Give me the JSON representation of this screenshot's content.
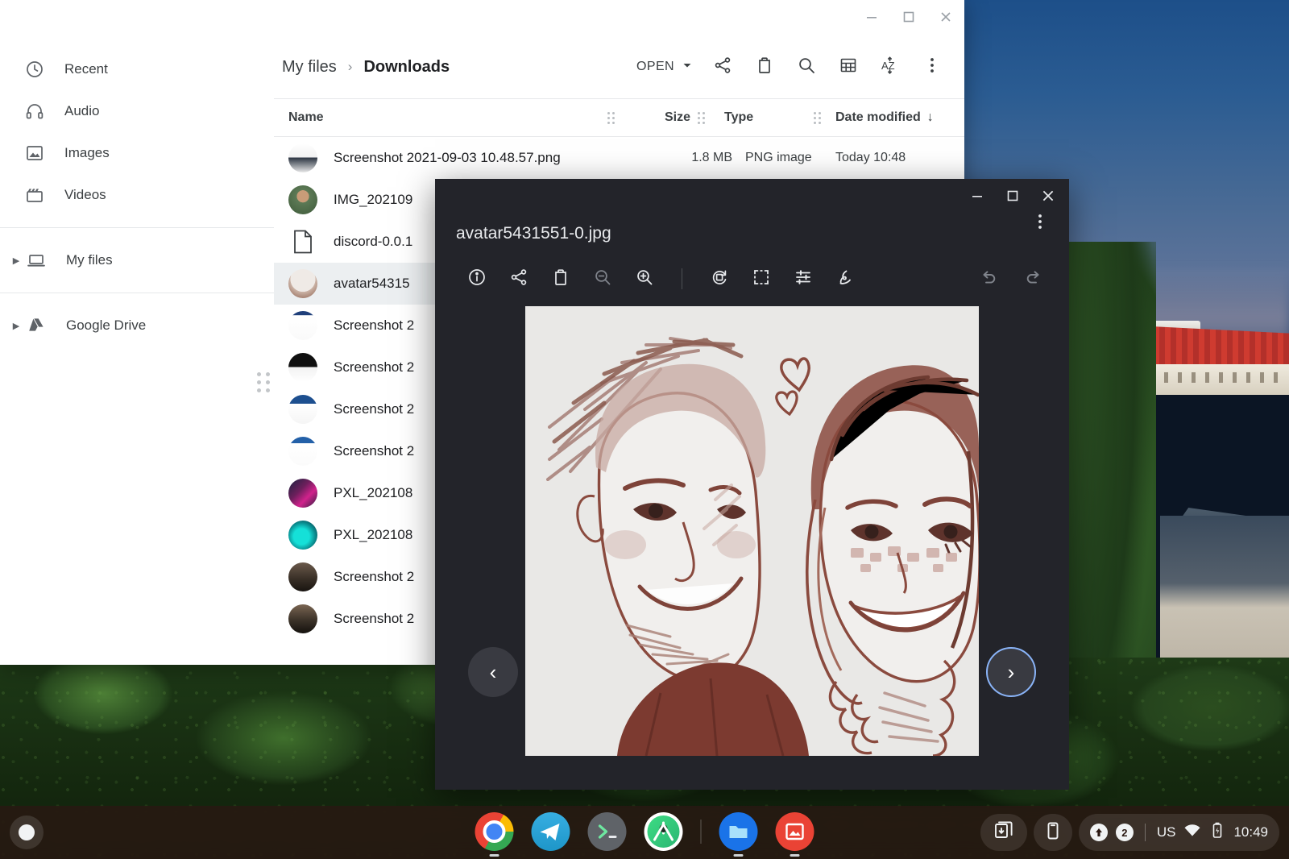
{
  "desktop": {
    "wallpaper_description": "Tallinn old town at dusk with red roofs and green trees"
  },
  "files_app": {
    "window_controls": [
      {
        "name": "minimize",
        "glyph": "minimize-icon"
      },
      {
        "name": "maximize",
        "glyph": "maximize-icon"
      },
      {
        "name": "close",
        "glyph": "close-icon"
      }
    ],
    "sidebar": {
      "items": [
        {
          "label": "Recent",
          "icon": "clock-icon",
          "expandable": false
        },
        {
          "label": "Audio",
          "icon": "headphones-icon",
          "expandable": false
        },
        {
          "label": "Images",
          "icon": "image-icon",
          "expandable": false
        },
        {
          "label": "Videos",
          "icon": "video-icon",
          "expandable": false
        },
        {
          "label": "My files",
          "icon": "laptop-icon",
          "expandable": true
        },
        {
          "label": "Google Drive",
          "icon": "google-drive-icon",
          "expandable": true
        }
      ]
    },
    "breadcrumb": {
      "root": "My files",
      "separator": "›",
      "current": "Downloads"
    },
    "toolbar": {
      "open_label": "OPEN",
      "buttons": [
        {
          "name": "share-button",
          "icon": "share-icon"
        },
        {
          "name": "delete-button",
          "icon": "trash-icon"
        },
        {
          "name": "search-button",
          "icon": "search-icon"
        },
        {
          "name": "view-toggle-button",
          "icon": "grid-icon"
        },
        {
          "name": "sort-button",
          "icon": "sort-az-icon"
        },
        {
          "name": "more-button",
          "icon": "more-vertical-icon"
        }
      ]
    },
    "table": {
      "columns": [
        "Name",
        "Size",
        "Type",
        "Date modified"
      ],
      "sort_indicator": "↓",
      "rows": [
        {
          "name": "Screenshot 2021-09-03 10.48.57.png",
          "size": "1.8 MB",
          "type": "PNG image",
          "date": "Today 10:48",
          "thumb": "screenshot",
          "selected": false
        },
        {
          "name": "IMG_202109",
          "size": "",
          "type": "",
          "date": "",
          "thumb": "photo-person",
          "selected": false
        },
        {
          "name": "discord-0.0.1",
          "size": "",
          "type": "",
          "date": "",
          "thumb": "generic-file",
          "selected": false
        },
        {
          "name": "avatar54315",
          "size": "",
          "type": "",
          "date": "",
          "thumb": "avatar-sketch",
          "selected": true
        },
        {
          "name": "Screenshot 2",
          "size": "",
          "type": "",
          "date": "",
          "thumb": "screenshot-blue",
          "selected": false
        },
        {
          "name": "Screenshot 2",
          "size": "",
          "type": "",
          "date": "",
          "thumb": "screenshot-dark",
          "selected": false
        },
        {
          "name": "Screenshot 2",
          "size": "",
          "type": "",
          "date": "",
          "thumb": "screenshot-blue2",
          "selected": false
        },
        {
          "name": "Screenshot 2",
          "size": "",
          "type": "",
          "date": "",
          "thumb": "screenshot-blue3",
          "selected": false
        },
        {
          "name": "PXL_202108",
          "size": "",
          "type": "",
          "date": "",
          "thumb": "photo-pink",
          "selected": false
        },
        {
          "name": "PXL_202108",
          "size": "",
          "type": "",
          "date": "",
          "thumb": "photo-teal",
          "selected": false
        },
        {
          "name": "Screenshot 2",
          "size": "",
          "type": "",
          "date": "",
          "thumb": "photo-dark1",
          "selected": false
        },
        {
          "name": "Screenshot 2",
          "size": "",
          "type": "",
          "date": "",
          "thumb": "photo-dark2",
          "selected": false
        }
      ]
    }
  },
  "image_viewer": {
    "filename": "avatar5431551-0.jpg",
    "window_controls": [
      {
        "name": "minimize",
        "glyph": "minimize-icon"
      },
      {
        "name": "maximize",
        "glyph": "maximize-icon"
      },
      {
        "name": "close",
        "glyph": "close-icon"
      }
    ],
    "more_menu_icon": "more-vertical-icon",
    "toolbar": [
      {
        "name": "info-button",
        "icon": "info-icon",
        "dimmed": false
      },
      {
        "name": "share-button",
        "icon": "share-icon",
        "dimmed": false
      },
      {
        "name": "delete-button",
        "icon": "trash-icon",
        "dimmed": false
      },
      {
        "name": "zoom-out-button",
        "icon": "zoom-out-icon",
        "dimmed": true
      },
      {
        "name": "zoom-in-button",
        "icon": "zoom-in-icon",
        "dimmed": false
      },
      {
        "name": "rotate-button",
        "icon": "rotate-icon",
        "dimmed": false
      },
      {
        "name": "crop-button",
        "icon": "crop-icon",
        "dimmed": false
      },
      {
        "name": "adjust-button",
        "icon": "sliders-icon",
        "dimmed": false
      },
      {
        "name": "annotate-button",
        "icon": "scribble-icon",
        "dimmed": false
      },
      {
        "name": "undo-button",
        "icon": "undo-icon",
        "dimmed": true
      },
      {
        "name": "redo-button",
        "icon": "redo-icon",
        "dimmed": true
      }
    ],
    "nav": {
      "prev": "‹",
      "next": "›"
    },
    "image_alt": "Sketch illustration of a man and a woman smiling, brown ink on light background"
  },
  "shelf": {
    "launcher_icon": "launcher-icon",
    "apps": [
      {
        "name": "chrome",
        "running": true
      },
      {
        "name": "telegram",
        "running": false
      },
      {
        "name": "terminal",
        "running": false
      },
      {
        "name": "android-studio",
        "running": false
      },
      {
        "name": "files",
        "running": true
      },
      {
        "name": "gallery",
        "running": true
      }
    ],
    "tray": {
      "icons": [
        {
          "name": "screen-capture-icon"
        },
        {
          "name": "phone-hub-icon"
        }
      ],
      "notification_count": "2",
      "keyboard_layout": "US",
      "wifi_icon": "wifi-icon",
      "battery_icon": "battery-charging-icon",
      "time": "10:49"
    }
  },
  "colors": {
    "accent_blue": "#8ab4f8",
    "viewer_bg": "#23242a",
    "shelf_bg": "#2a1812",
    "files_bg": "#ffffff",
    "text_primary": "#202124",
    "text_secondary": "#3c4043"
  }
}
